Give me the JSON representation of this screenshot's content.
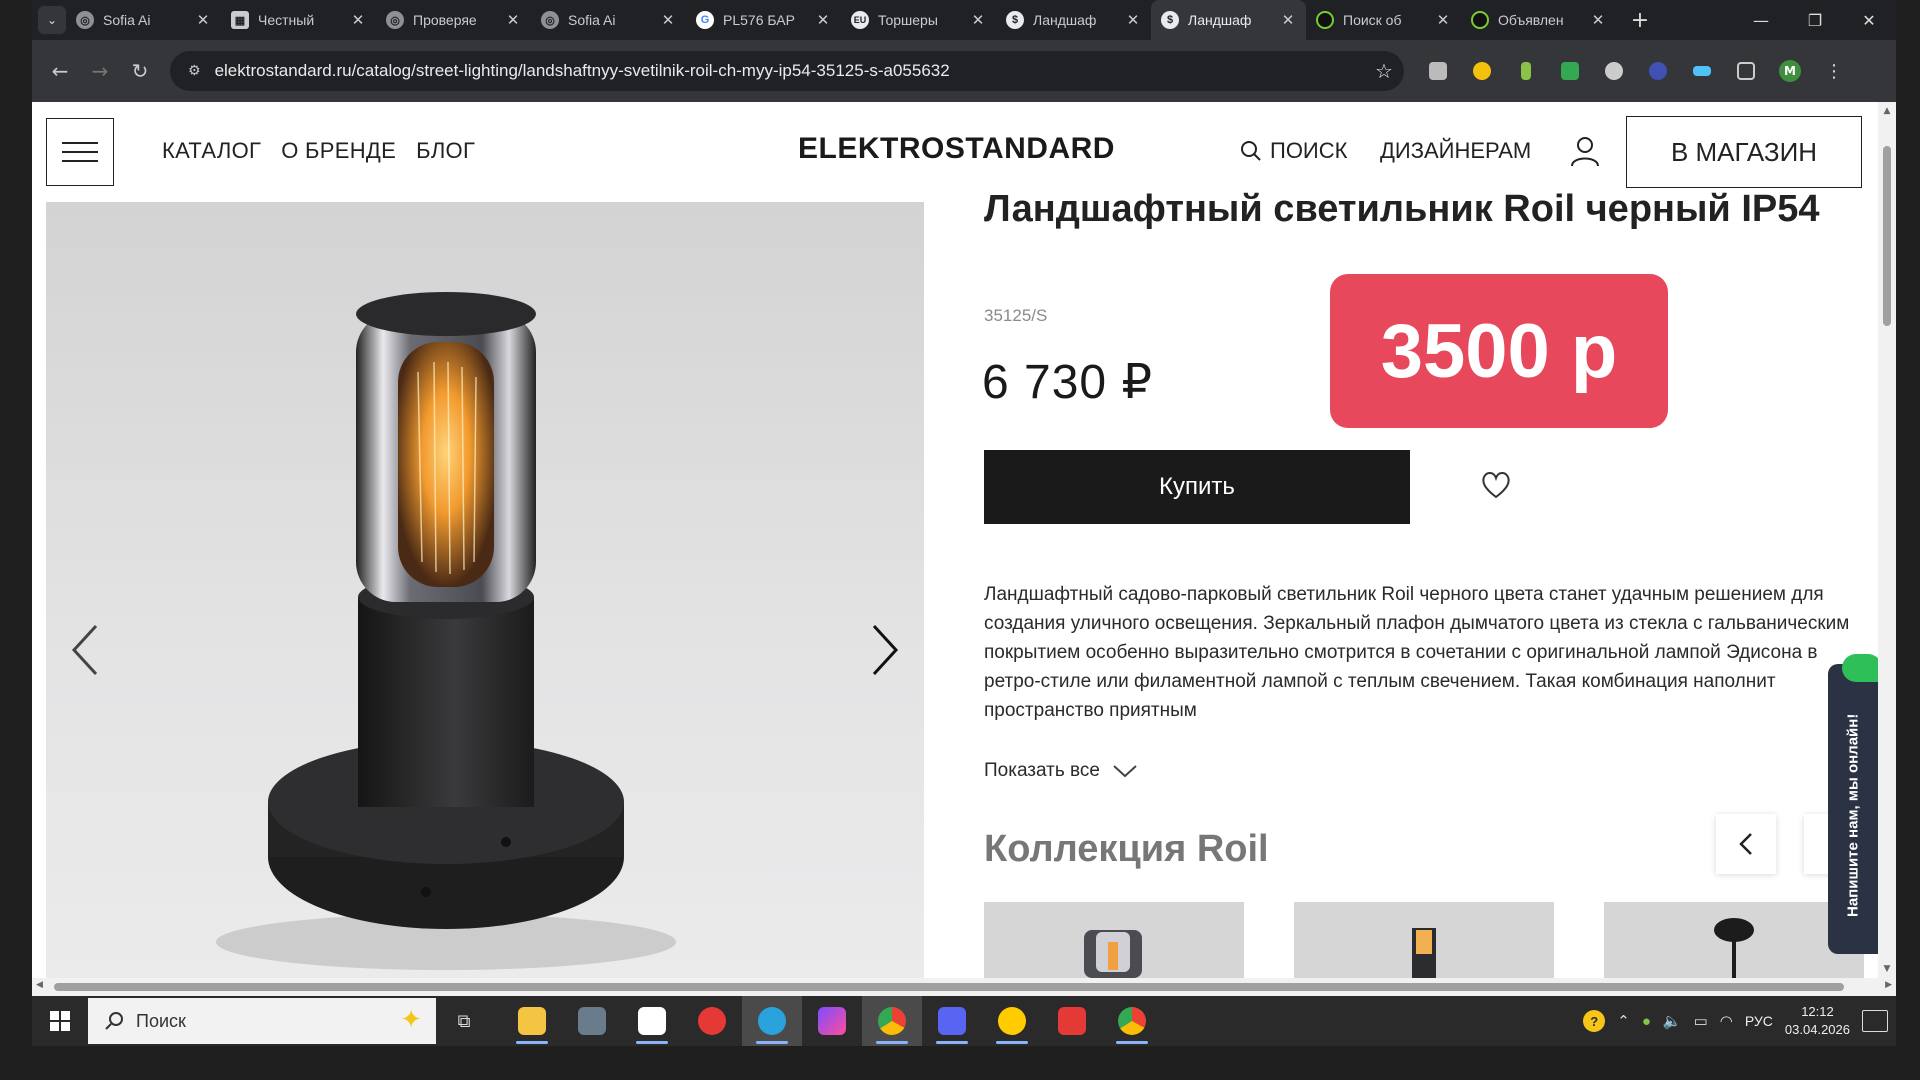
{
  "browser": {
    "tabs": [
      {
        "title": "Sofia Ai",
        "icon": "openai-icon",
        "active": false
      },
      {
        "title": "Честный",
        "icon": "calendar-icon",
        "active": false
      },
      {
        "title": "Проверяе",
        "icon": "openai-icon",
        "active": false
      },
      {
        "title": "Sofia Ai",
        "icon": "openai-icon",
        "active": false
      },
      {
        "title": "PL576 БАР",
        "icon": "google-icon",
        "active": false
      },
      {
        "title": "Торшеры",
        "icon": "eu-icon",
        "active": false
      },
      {
        "title": "Ландшаф",
        "icon": "elektrostandard-icon",
        "active": false
      },
      {
        "title": "Ландшаф",
        "icon": "elektrostandard-icon",
        "active": true
      },
      {
        "title": "Поиск об",
        "icon": "avito-icon",
        "active": false
      },
      {
        "title": "Объявлен",
        "icon": "avito-icon",
        "active": false
      }
    ],
    "close_glyph": "✕",
    "new_tab_glyph": "+",
    "url": "elektrostandard.ru/catalog/street-lighting/landshaftnyy-svetilnik-roil-ch-myy-ip54-35125-s-a055632"
  },
  "site": {
    "nav": [
      "КАТАЛОГ",
      "О БРЕНДЕ",
      "БЛОГ"
    ],
    "logo": "ELEKTROSTANDARD",
    "search_label": "ПОИСК",
    "designers_label": "ДИЗАЙНЕРАМ",
    "store_button": "В МАГАЗИН"
  },
  "product": {
    "title": "Ландшафтный светильник Roil черный IP54",
    "sku": "35125/S",
    "price": "6 730 ₽",
    "promo_price": "3500 р",
    "buy_label": "Купить",
    "description": "Ландшафтный садово-парковый светильник Roil черного цвета станет удачным решением для создания уличного освещения. Зеркальный плафон дымчатого цвета из стекла с гальваническим покрытием особенно выразительно смотрится в сочетании с оригинальной лампой Эдисона в ретро-стиле или филаментной лампой с теплым свечением. Такая комбинация наполнит пространство приятным",
    "show_all": "Показать все",
    "collection_title": "Коллекция Roil"
  },
  "chat_widget": {
    "label": "Напишите нам, мы онлайн!"
  },
  "taskbar": {
    "search_placeholder": "Поиск",
    "apps": [
      "file-explorer-icon",
      "calculator-icon",
      "unknown-app-icon",
      "yandex-browser-icon",
      "telegram-icon",
      "affinity-icon",
      "chrome-icon",
      "discord-icon",
      "yandex-music-icon",
      "wps-office-icon",
      "chrome-alt-icon"
    ],
    "lang": "РУС",
    "time": "12:12",
    "date": "03.04.2026"
  },
  "colors": {
    "promo_bg": "#e8485c",
    "buy_bg": "#1a1a1a",
    "chat_bg": "#2b3244",
    "chat_dot": "#2fbf58"
  }
}
